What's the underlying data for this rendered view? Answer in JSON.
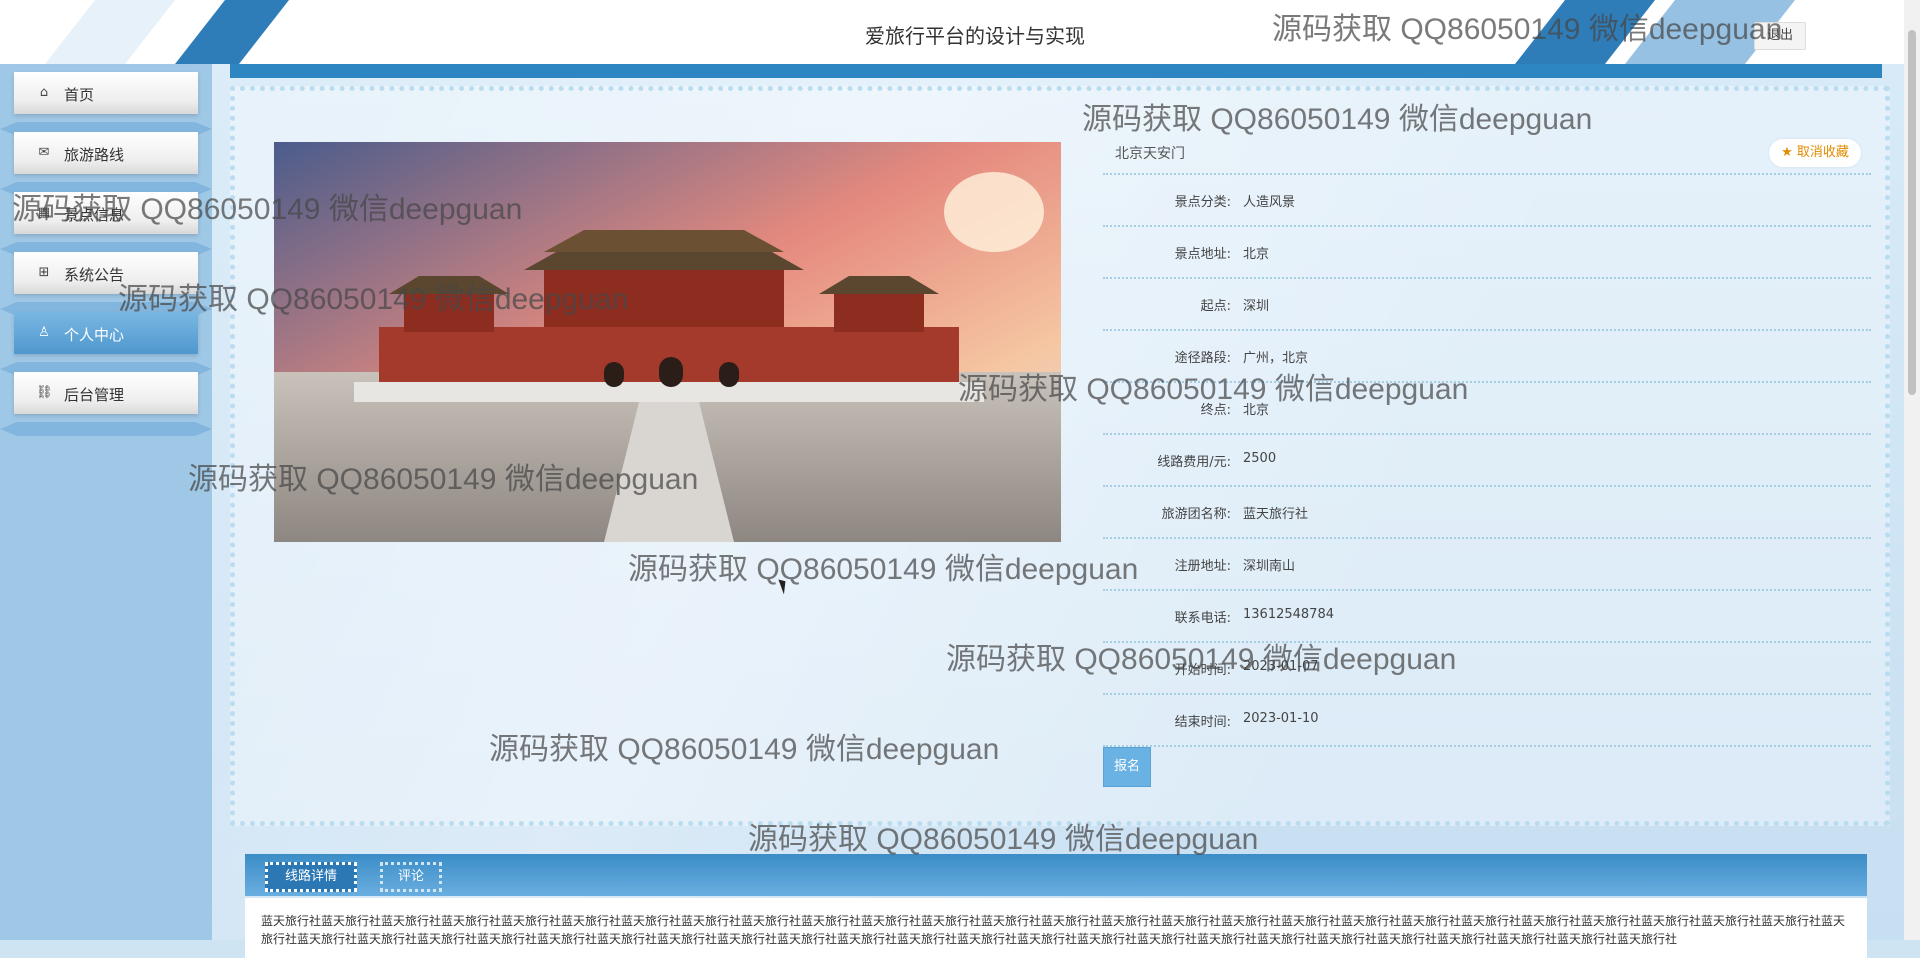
{
  "header": {
    "title": "爱旅行平台的设计与实现",
    "logout_label": "退出"
  },
  "sidebar": {
    "items": [
      {
        "label": "首页",
        "icon": "home-icon",
        "active": false
      },
      {
        "label": "旅游路线",
        "icon": "mail-icon",
        "active": false
      },
      {
        "label": "景点信息",
        "icon": "grid-icon",
        "active": false
      },
      {
        "label": "系统公告",
        "icon": "gift-icon",
        "active": false
      },
      {
        "label": "个人中心",
        "icon": "user-icon",
        "active": true
      },
      {
        "label": "后台管理",
        "icon": "link-icon",
        "active": false
      }
    ]
  },
  "route": {
    "name": "北京天安门",
    "favorite_label": "取消收藏",
    "fields": [
      {
        "label": "景点分类:",
        "value": "人造风景"
      },
      {
        "label": "景点地址:",
        "value": "北京"
      },
      {
        "label": "起点:",
        "value": "深圳"
      },
      {
        "label": "途径路段:",
        "value": "广州，北京"
      },
      {
        "label": "终点:",
        "value": "北京"
      },
      {
        "label": "线路费用/元:",
        "value": "2500"
      },
      {
        "label": "旅游团名称:",
        "value": "蓝天旅行社"
      },
      {
        "label": "注册地址:",
        "value": "深圳南山"
      },
      {
        "label": "联系电话:",
        "value": "13612548784"
      },
      {
        "label": "开始时间:",
        "value": "2023-01-07"
      },
      {
        "label": "结束时间:",
        "value": "2023-01-10"
      }
    ],
    "signup_label": "报名"
  },
  "tabs": {
    "detail_label": "线路详情",
    "comment_label": "评论"
  },
  "detail_text": "蓝天旅行社蓝天旅行社蓝天旅行社蓝天旅行社蓝天旅行社蓝天旅行社蓝天旅行社蓝天旅行社蓝天旅行社蓝天旅行社蓝天旅行社蓝天旅行社蓝天旅行社蓝天旅行社蓝天旅行社蓝天旅行社蓝天旅行社蓝天旅行社蓝天旅行社蓝天旅行社蓝天旅行社蓝天旅行社蓝天旅行社蓝天旅行社蓝天旅行社蓝天旅行社蓝天旅行社蓝天旅行社蓝天旅行社蓝天旅行社蓝天旅行社蓝天旅行社蓝天旅行社蓝天旅行社蓝天旅行社蓝天旅行社蓝天旅行社蓝天旅行社蓝天旅行社蓝天旅行社蓝天旅行社蓝天旅行社蓝天旅行社蓝天旅行社蓝天旅行社蓝天旅行社蓝天旅行社蓝天旅行社蓝天旅行社蓝天旅行社",
  "watermark": "源码获取 QQ86050149 微信deepguan",
  "colors": {
    "accent": "#2d86c2",
    "favorite": "#e08b00",
    "signup": "#6ab2e3"
  }
}
